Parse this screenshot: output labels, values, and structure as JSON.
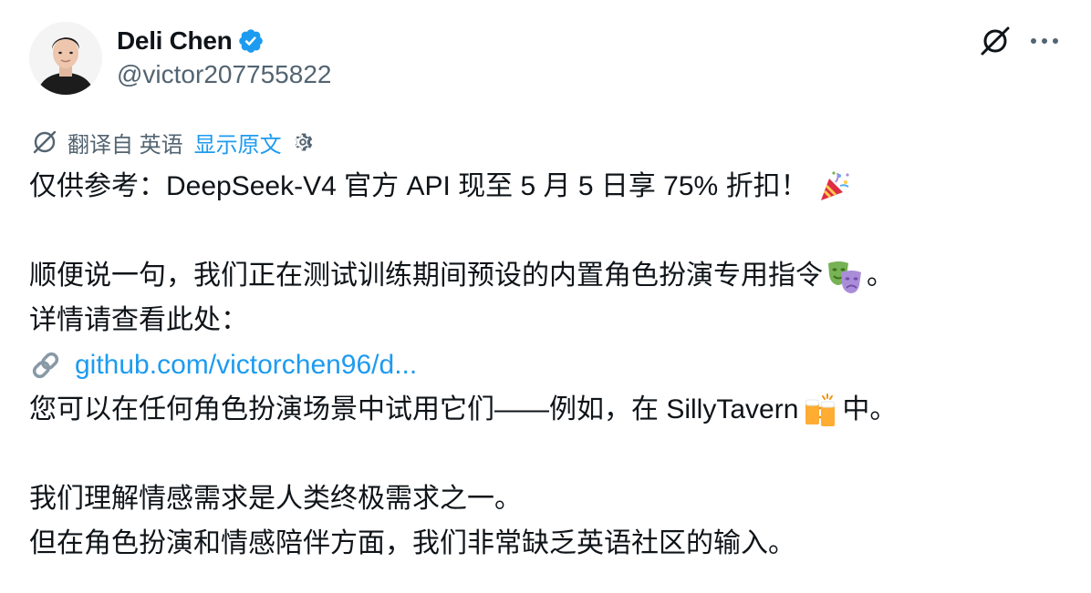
{
  "author": {
    "name": "Deli Chen",
    "handle": "@victor207755822",
    "verified": true
  },
  "actions": {
    "grok_icon": "grok-icon",
    "more_icon": "more-icon"
  },
  "translation": {
    "translated_from": "翻译自 英语",
    "show_original": "显示原文"
  },
  "tweet": {
    "line1": "仅供参考：DeepSeek-V4 官方 API 现至 5 月 5 日享 75% 折扣！",
    "line3_before": "顺便说一句，我们正在测试训练期间预设的内置角色扮演专用指令",
    "line3_after": "。",
    "line4": "详情请查看此处：",
    "link": "github.com/victorchen96/d...",
    "line6_before": "您可以在任何角色扮演场景中试用它们——例如，在 SillyTavern",
    "line6_after": "中。",
    "line8": "我们理解情感需求是人类终极需求之一。",
    "line9": "但在角色扮演和情感陪伴方面，我们非常缺乏英语社区的输入。"
  },
  "icons": {
    "party": "party-popper-emoji",
    "masks": "performing-arts-emoji",
    "beers": "clinking-beer-mugs-emoji",
    "link": "link-icon"
  },
  "colors": {
    "text": "#0f1419",
    "secondary": "#536471",
    "accent": "#1d9bf0"
  }
}
